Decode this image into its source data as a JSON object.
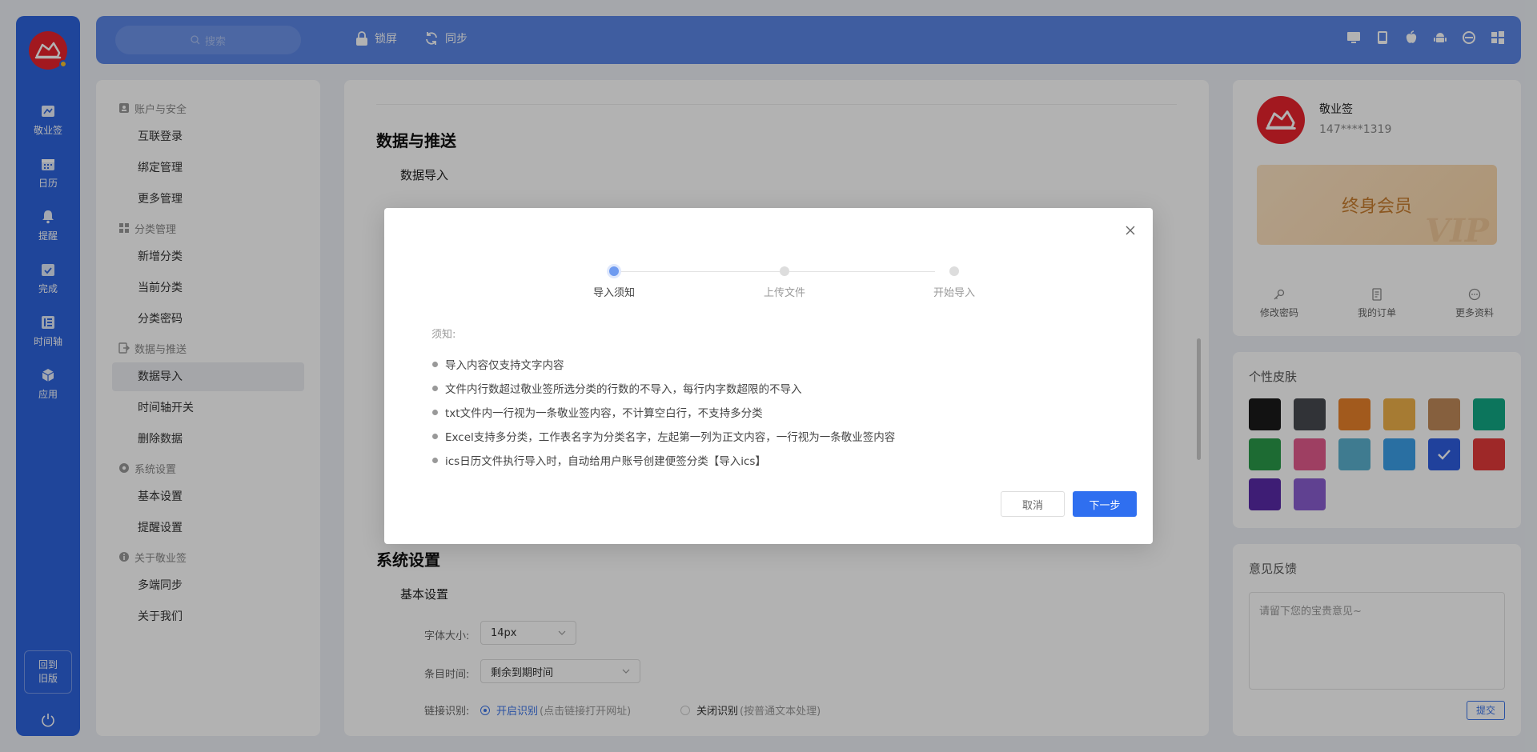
{
  "rail": {
    "items": [
      {
        "label": "敬业签",
        "icon": "note-icon"
      },
      {
        "label": "日历",
        "icon": "calendar-icon"
      },
      {
        "label": "提醒",
        "icon": "bell-icon"
      },
      {
        "label": "完成",
        "icon": "check-calendar-icon"
      },
      {
        "label": "时间轴",
        "icon": "timeline-icon"
      },
      {
        "label": "应用",
        "icon": "cube-icon"
      }
    ],
    "back_old_line1": "回到",
    "back_old_line2": "旧版"
  },
  "topbar": {
    "search_placeholder": "搜索",
    "lock_label": "锁屏",
    "sync_label": "同步",
    "platforms": [
      "desktop-icon",
      "tablet-icon",
      "apple-icon",
      "android-icon",
      "browser-icon",
      "windows-icon"
    ]
  },
  "nav": {
    "groups": [
      {
        "title": "账户与安全",
        "items": [
          "互联登录",
          "绑定管理",
          "更多管理"
        ]
      },
      {
        "title": "分类管理",
        "items": [
          "新增分类",
          "当前分类",
          "分类密码"
        ]
      },
      {
        "title": "数据与推送",
        "items": [
          "数据导入",
          "时间轴开关",
          "删除数据"
        ]
      },
      {
        "title": "系统设置",
        "items": [
          "基本设置",
          "提醒设置"
        ]
      },
      {
        "title": "关于敬业签",
        "items": [
          "多端同步",
          "关于我们"
        ]
      }
    ],
    "active_item": "数据导入"
  },
  "main": {
    "section_data": "数据与推送",
    "sub_import": "数据导入",
    "section_system": "系统设置",
    "sub_basic": "基本设置",
    "font_size_label": "字体大小:",
    "font_size_value": "14px",
    "item_time_label": "条目时间:",
    "item_time_value": "剩余到期时间",
    "link_label": "链接识别:",
    "link_on": "开启识别",
    "link_on_hint": "(点击链接打开网址)",
    "link_off": "关闭识别",
    "link_off_hint": "(按普通文本处理)"
  },
  "profile": {
    "name": "敬业签",
    "phone": "147****1319",
    "vip_label": "终身会员",
    "vip_watermark": "VIP",
    "actions": [
      {
        "label": "修改密码",
        "icon": "key-icon"
      },
      {
        "label": "我的订单",
        "icon": "order-icon"
      },
      {
        "label": "更多资料",
        "icon": "more-icon"
      }
    ]
  },
  "skin": {
    "title": "个性皮肤",
    "colors": [
      "#1a1a1a",
      "#474a4f",
      "#e8822a",
      "#eeb04a",
      "#c08a5a",
      "#12a884",
      "#2a9a4a",
      "#e25b8d",
      "#5bb0cf",
      "#3b9fe8",
      "#2e5ee0",
      "#e33a3a",
      "#5a2aa8",
      "#8a5ed0"
    ],
    "selected_index": 10
  },
  "feedback": {
    "title": "意见反馈",
    "placeholder": "请留下您的宝贵意见~",
    "submit": "提交"
  },
  "modal": {
    "steps": [
      "导入须知",
      "上传文件",
      "开始导入"
    ],
    "active_step": 0,
    "notice_title": "须知:",
    "rules": [
      "导入内容仅支持文字内容",
      "文件内行数超过敬业签所选分类的行数的不导入，每行内字数超限的不导入",
      "txt文件内一行视为一条敬业签内容，不计算空白行，不支持多分类",
      "Excel支持多分类，工作表名字为分类名字，左起第一列为正文内容，一行视为一条敬业签内容",
      "ics日历文件执行导入时，自动给用户账号创建便签分类【导入ics】"
    ],
    "cancel": "取消",
    "next": "下一步"
  }
}
